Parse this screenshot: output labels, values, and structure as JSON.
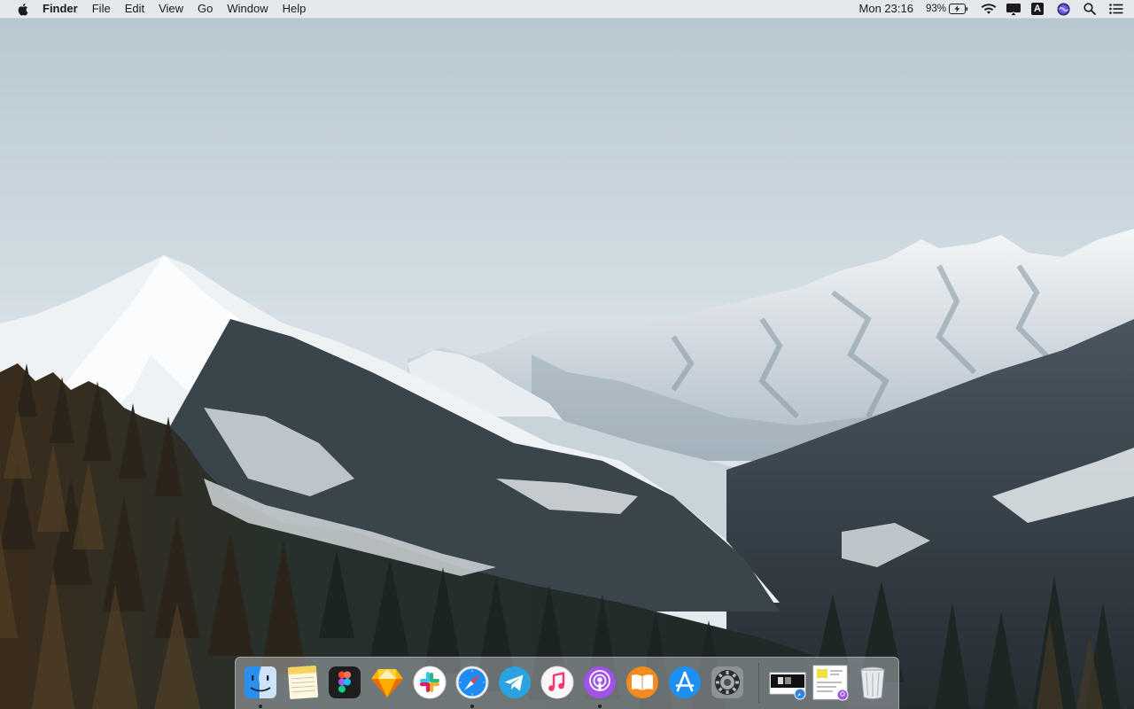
{
  "menubar": {
    "apple_icon": "apple-logo-icon",
    "app_name": "Finder",
    "menus": [
      "File",
      "Edit",
      "View",
      "Go",
      "Window",
      "Help"
    ],
    "clock": "Mon 23:16",
    "battery_percent": "93%",
    "status_icons": [
      "battery-charging-icon",
      "wifi-icon",
      "airplay-display-icon",
      "input-source-icon",
      "siri-icon",
      "spotlight-search-icon",
      "notification-center-icon"
    ],
    "input_source_letter": "A"
  },
  "dock": {
    "apps": [
      {
        "name": "Finder",
        "icon": "finder-icon",
        "running": true
      },
      {
        "name": "Notes",
        "icon": "notes-icon",
        "running": false
      },
      {
        "name": "Figma",
        "icon": "figma-icon",
        "running": false
      },
      {
        "name": "Sketch",
        "icon": "sketch-icon",
        "running": false
      },
      {
        "name": "Slack",
        "icon": "slack-icon",
        "running": false
      },
      {
        "name": "Safari",
        "icon": "safari-icon",
        "running": true
      },
      {
        "name": "Telegram",
        "icon": "telegram-icon",
        "running": false
      },
      {
        "name": "iTunes",
        "icon": "itunes-icon",
        "running": false
      },
      {
        "name": "Podcasts",
        "icon": "podcasts-icon",
        "running": true
      },
      {
        "name": "Books",
        "icon": "books-icon",
        "running": false
      },
      {
        "name": "App Store",
        "icon": "app-store-icon",
        "running": false
      },
      {
        "name": "System Preferences",
        "icon": "system-preferences-icon",
        "running": false
      }
    ],
    "stacks": [
      {
        "icon": "minimized-window-safari-icon"
      },
      {
        "icon": "minimized-window-podcasts-icon"
      },
      {
        "icon": "trash-icon"
      }
    ]
  },
  "colors": {
    "sky_top": "#b9c8d1",
    "sky_horizon": "#e3eaee",
    "snow": "#eef2f5",
    "rock": "#6b7c88",
    "forest": "#2a3330",
    "forest_warm": "#6b5334"
  }
}
